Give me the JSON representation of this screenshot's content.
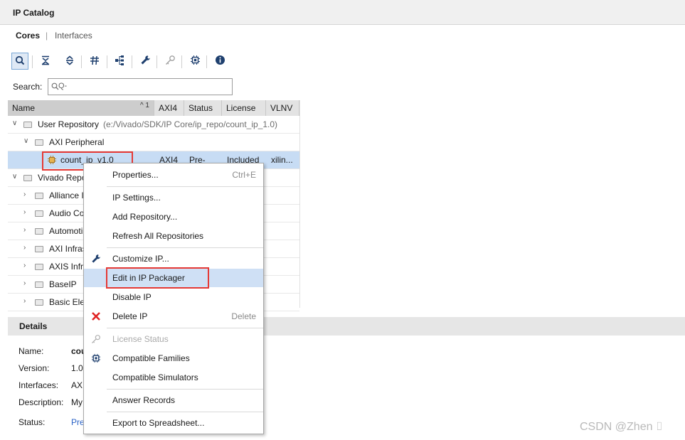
{
  "window": {
    "title": "IP Catalog"
  },
  "tabs": [
    {
      "label": "Cores"
    },
    {
      "label": "Interfaces"
    }
  ],
  "tab_separator": "|",
  "search": {
    "label": "Search:",
    "placeholder": "Q-",
    "value": ""
  },
  "table": {
    "columns": [
      "Name",
      "AXI4",
      "Status",
      "License",
      "VLNV"
    ],
    "sort_indicator": "^ 1",
    "rows": [
      {
        "name": "User Repository",
        "path": "(e:/Vivado/SDK/IP Core/ip_repo/count_ip_1.0)"
      },
      {
        "name": "AXI Peripheral"
      },
      {
        "name": "count_ip_v1.0",
        "axi4": "AXI4",
        "status": "Pre-",
        "license": "Included",
        "vlnv": "xilin..."
      },
      {
        "name": "Vivado Repo"
      },
      {
        "name": "Alliance I"
      },
      {
        "name": "Audio Co"
      },
      {
        "name": "Automoti"
      },
      {
        "name": "AXI Infras"
      },
      {
        "name": "AXIS Infra"
      },
      {
        "name": "BaseIP"
      },
      {
        "name": "Basic Ele"
      }
    ]
  },
  "details": {
    "title": "Details",
    "fields": [
      {
        "label": "Name:",
        "value": "cou"
      },
      {
        "label": "Version:",
        "value": "1.0"
      },
      {
        "label": "Interfaces:",
        "value": "AXI"
      },
      {
        "label": "Description:",
        "value": "My"
      },
      {
        "label": "Status:",
        "value": "Pre"
      }
    ]
  },
  "context_menu": {
    "items": [
      {
        "label": "Properties...",
        "shortcut": "Ctrl+E"
      },
      {
        "label": "IP Settings..."
      },
      {
        "label": "Add Repository..."
      },
      {
        "label": "Refresh All Repositories"
      },
      {
        "label": "Customize IP...",
        "icon": "wrench-icon"
      },
      {
        "label": "Edit in IP Packager"
      },
      {
        "label": "Disable IP"
      },
      {
        "label": "Delete IP",
        "shortcut": "Delete",
        "icon": "red-x-icon"
      },
      {
        "label": "License Status",
        "icon": "key-icon"
      },
      {
        "label": "Compatible Families",
        "icon": "chip-icon"
      },
      {
        "label": "Compatible Simulators"
      },
      {
        "label": "Answer Records"
      },
      {
        "label": "Export to Spreadsheet..."
      }
    ]
  },
  "toolbar": {
    "icons": [
      "search-icon",
      "collapse-all-icon",
      "expand-all-icon",
      "filter-icon",
      "hierarchy-icon",
      "wrench-icon",
      "key-icon",
      "chip-icon",
      "info-icon"
    ]
  },
  "watermark": "CSDN @Zhen ⌷",
  "colors": {
    "highlight_box": "#e53935",
    "selection": "#c7dcf4",
    "delete_icon": "#e02424"
  }
}
